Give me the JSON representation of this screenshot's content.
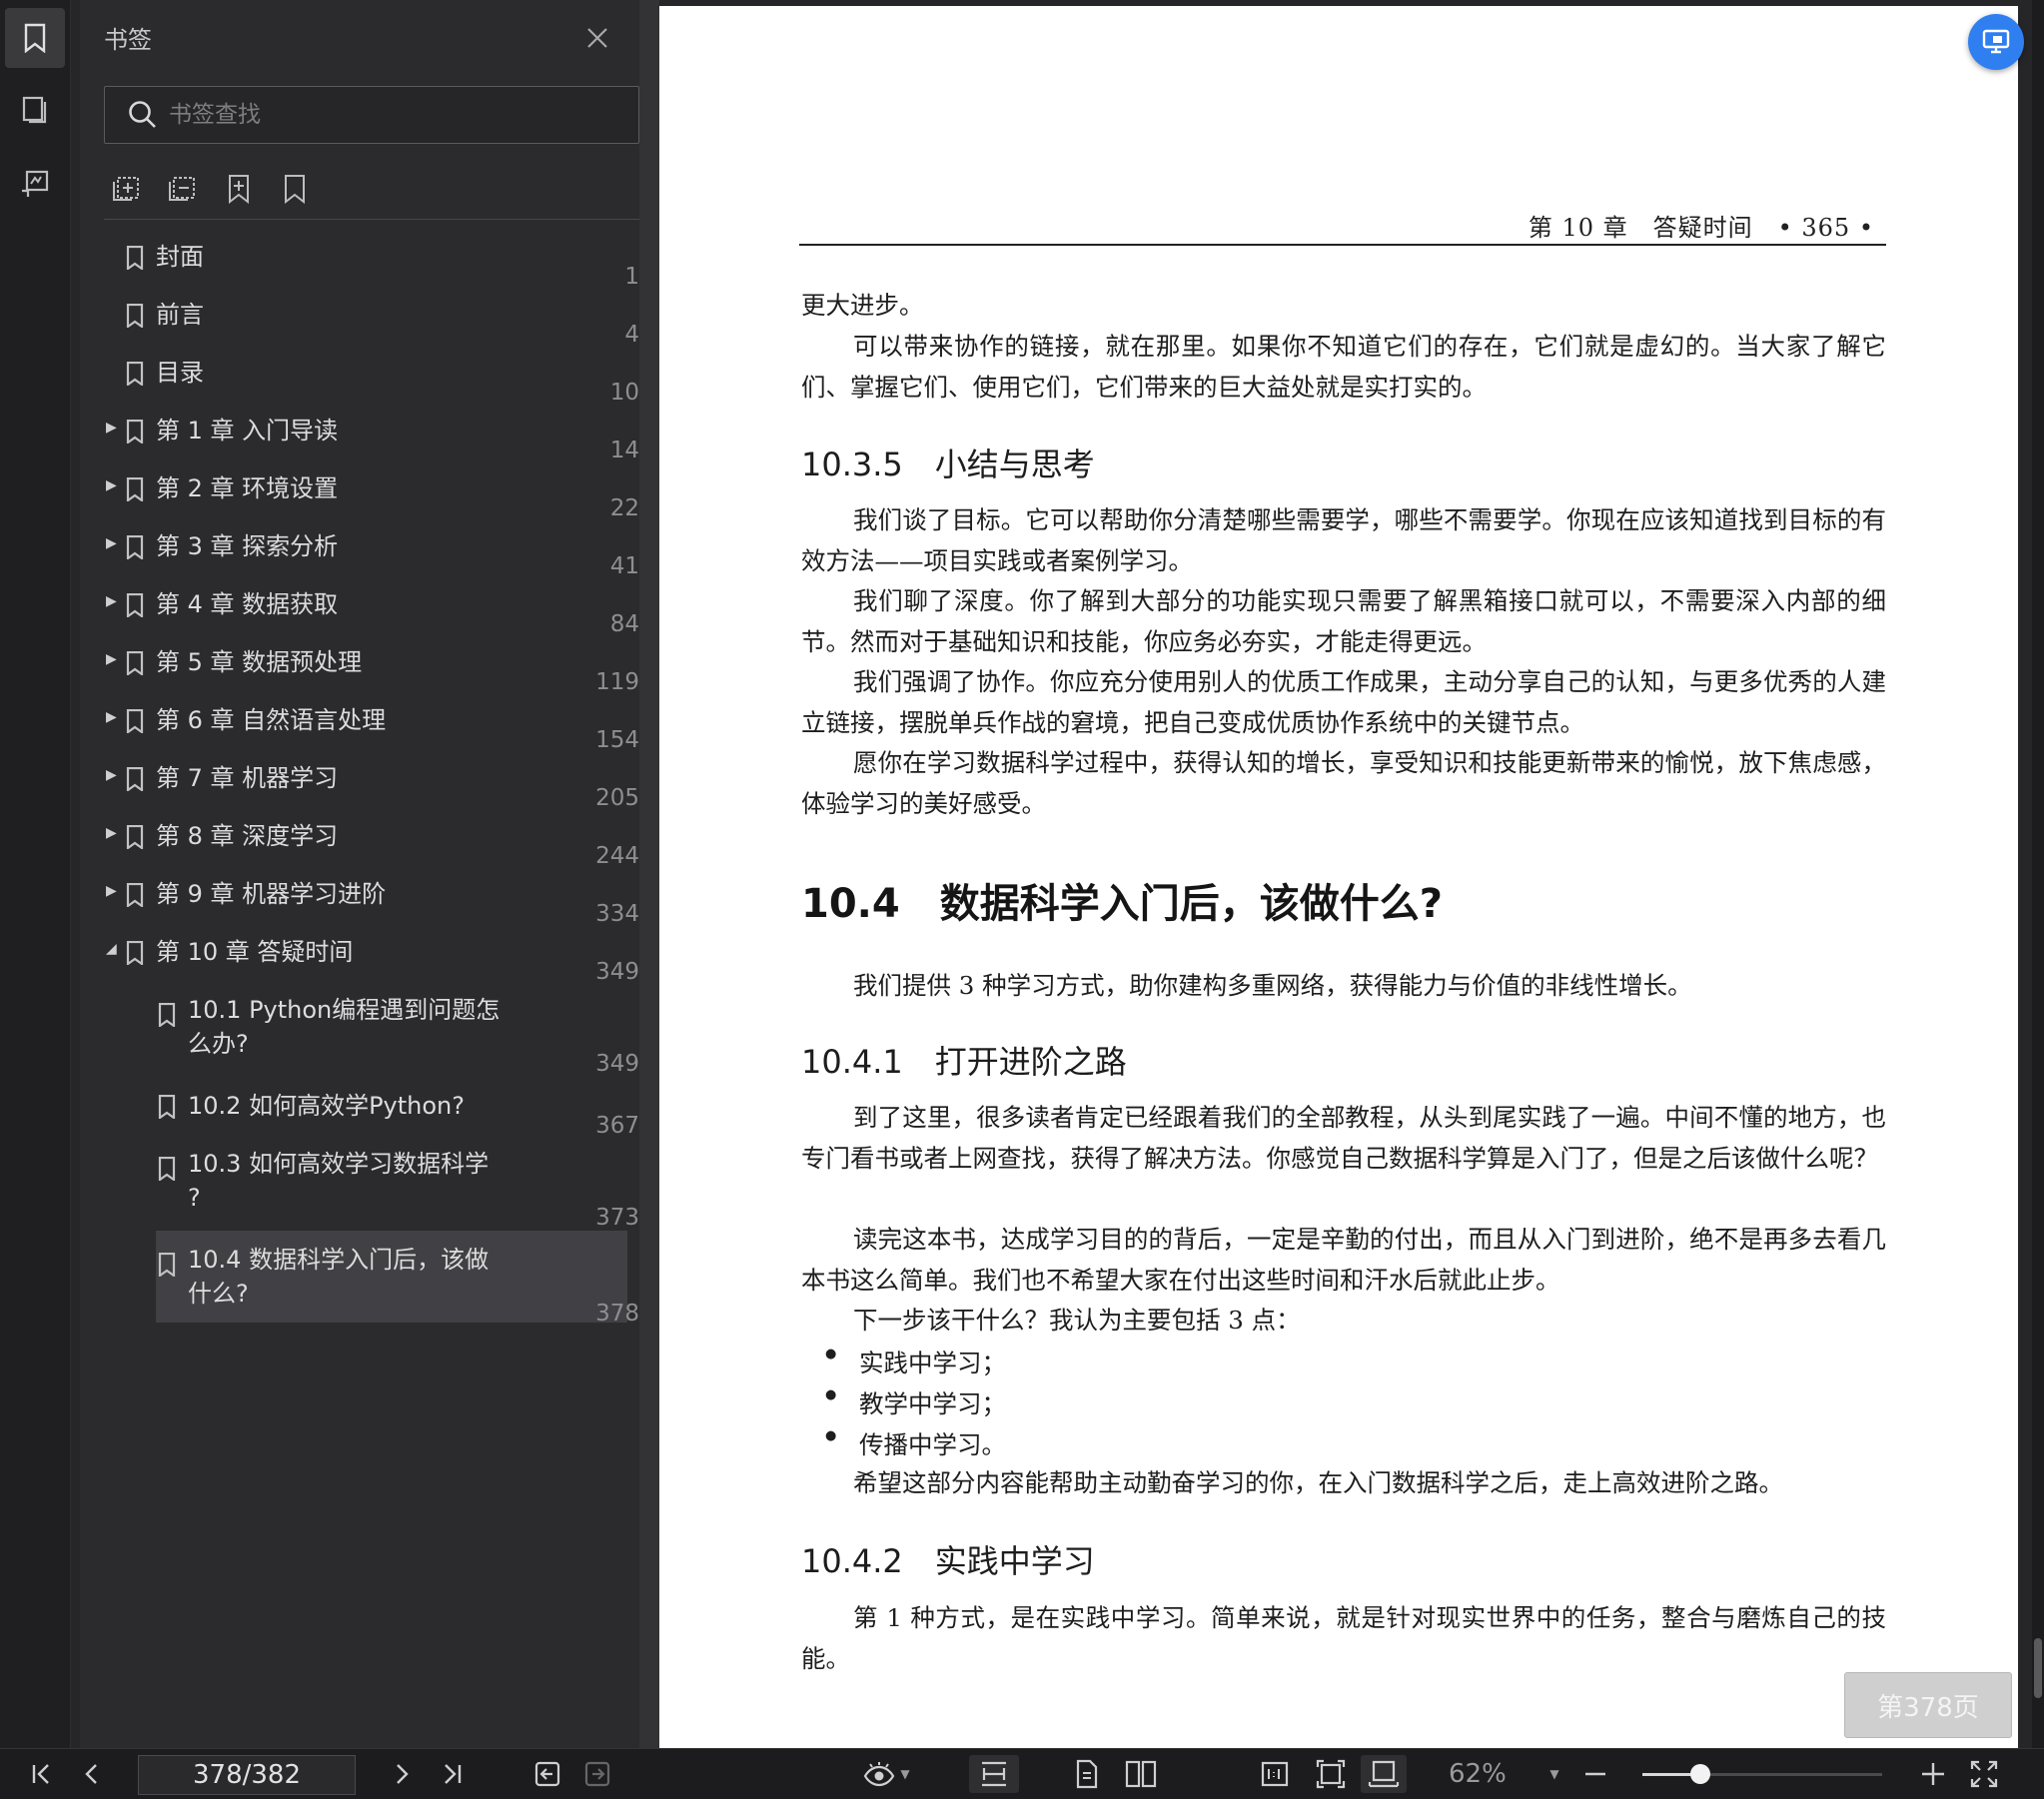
{
  "sidebar": {
    "rail": [
      {
        "name": "bookmark-tab",
        "icon": "bookmark-icon",
        "active": true
      },
      {
        "name": "thumbnail-tab",
        "icon": "page-thumbnail-icon",
        "active": false
      },
      {
        "name": "annotation-tab",
        "icon": "annotation-icon",
        "active": false
      }
    ],
    "panel_title": "书签",
    "search_placeholder": "书签查找",
    "tools": [
      "add-bookmark-icon",
      "add-sub-bookmark-icon",
      "bookmark-star-icon",
      "bookmark-outline-icon"
    ],
    "bookmarks": [
      {
        "label": "封面",
        "page": "1",
        "level": 0,
        "arrow": ""
      },
      {
        "label": "前言",
        "page": "4",
        "level": 0,
        "arrow": ""
      },
      {
        "label": "目录",
        "page": "10",
        "level": 0,
        "arrow": ""
      },
      {
        "label": "第 1 章 入门导读",
        "page": "14",
        "level": 0,
        "arrow": "▶"
      },
      {
        "label": "第 2 章 环境设置",
        "page": "22",
        "level": 0,
        "arrow": "▶"
      },
      {
        "label": "第 3 章 探索分析",
        "page": "41",
        "level": 0,
        "arrow": "▶"
      },
      {
        "label": "第 4 章 数据获取",
        "page": "84",
        "level": 0,
        "arrow": "▶"
      },
      {
        "label": "第 5 章 数据预处理",
        "page": "119",
        "level": 0,
        "arrow": "▶"
      },
      {
        "label": "第 6 章 自然语言处理",
        "page": "154",
        "level": 0,
        "arrow": "▶"
      },
      {
        "label": "第 7 章 机器学习",
        "page": "205",
        "level": 0,
        "arrow": "▶"
      },
      {
        "label": "第 8 章 深度学习",
        "page": "244",
        "level": 0,
        "arrow": "▶"
      },
      {
        "label": "第 9 章 机器学习进阶",
        "page": "334",
        "level": 0,
        "arrow": "▶"
      },
      {
        "label": "第 10 章 答疑时间",
        "page": "349",
        "level": 0,
        "arrow": "◢"
      },
      {
        "label": "10.1 Python编程遇到问题怎么办?",
        "line1": "10.1 Python编程遇到问题怎",
        "line2": "么办?",
        "page": "349",
        "level": 1
      },
      {
        "label": "10.2 如何高效学Python?",
        "page": "367",
        "level": 1
      },
      {
        "label": "10.3 如何高效学习数据科学?",
        "line1": "10.3 如何高效学习数据科学",
        "line2": "?",
        "page": "373",
        "level": 1
      },
      {
        "label": "10.4 数据科学入门后，该做什么?",
        "line1": "10.4 数据科学入门后，该做",
        "line2": "什么?",
        "page": "378",
        "level": 1,
        "selected": true
      }
    ]
  },
  "document": {
    "running_head": "第 10 章　答疑时间　• 365 •",
    "p1": "更大进步。",
    "p2": "可以带来协作的链接，就在那里。如果你不知道它们的存在，它们就是虚幻的。当大家了解它们、掌握它们、使用它们，它们带来的巨大益处就是实打实的。",
    "h_1035": "10.3.5　小结与思考",
    "p3": "我们谈了目标。它可以帮助你分清楚哪些需要学，哪些不需要学。你现在应该知道找到目标的有效方法——项目实践或者案例学习。",
    "p4": "我们聊了深度。你了解到大部分的功能实现只需要了解黑箱接口就可以，不需要深入内部的细节。然而对于基础知识和技能，你应务必夯实，才能走得更远。",
    "p5": "我们强调了协作。你应充分使用别人的优质工作成果，主动分享自己的认知，与更多优秀的人建立链接，摆脱单兵作战的窘境，把自己变成优质协作系统中的关键节点。",
    "p6": "愿你在学习数据科学过程中，获得认知的增长，享受知识和技能更新带来的愉悦，放下焦虑感，体验学习的美好感受。",
    "h_104": "10.4　数据科学入门后，该做什么?",
    "p7": "我们提供 3 种学习方式，助你建构多重网络，获得能力与价值的非线性增长。",
    "h_1041": "10.4.1　打开进阶之路",
    "p8": "到了这里，很多读者肯定已经跟着我们的全部教程，从头到尾实践了一遍。中间不懂的地方，也专门看书或者上网查找，获得了解决方法。你感觉自己数据科学算是入门了，但是之后该做什么呢？",
    "p9": "读完这本书，达成学习目的的背后，一定是辛勤的付出，而且从入门到进阶，绝不是再多去看几本书这么简单。我们也不希望大家在付出这些时间和汗水后就此止步。",
    "p10": "下一步该干什么？我认为主要包括 3 点：",
    "bullets": [
      "实践中学习；",
      "教学中学习；",
      "传播中学习。"
    ],
    "p11": "希望这部分内容能帮助主动勤奋学习的你，在入门数据科学之后，走上高效进阶之路。",
    "h_1042": "10.4.2　实践中学习",
    "p12": "第 1 种方式，是在实践中学习。简单来说，就是针对现实世界中的任务，整合与磨炼自己的技能。"
  },
  "page_badge": "第378页",
  "toolbar": {
    "page_value": "378/382",
    "zoom_label": "62%",
    "zoom_fraction": 0.24
  },
  "colors": {
    "accent": "#2f7ff0",
    "panel": "#2b2b2e",
    "page": "#ffffff"
  }
}
